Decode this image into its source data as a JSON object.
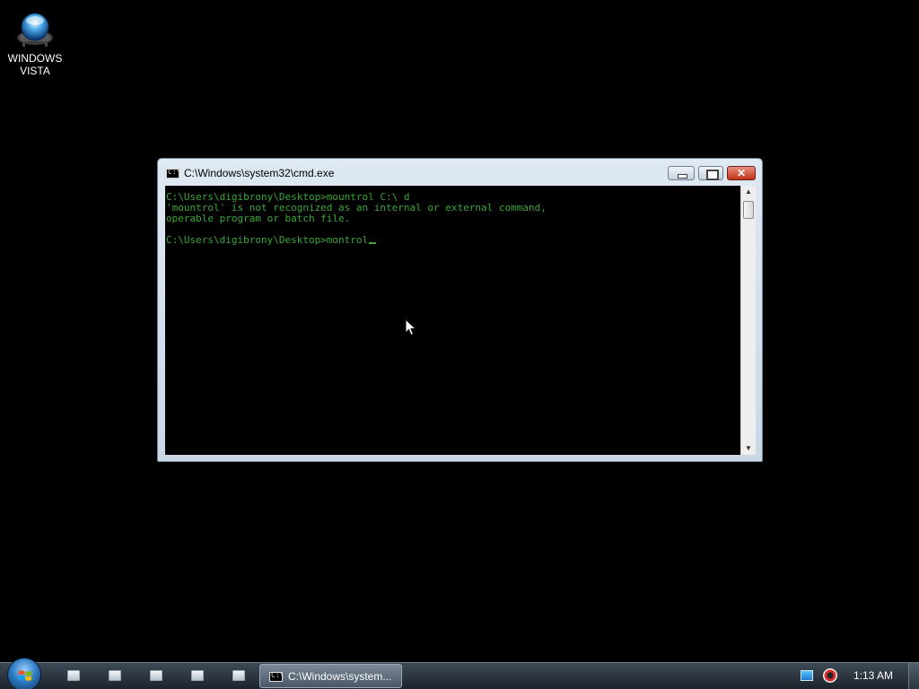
{
  "desktop": {
    "icons": [
      {
        "label": "WINDOWS\nVISTA",
        "icon": "vista-orb-icon"
      }
    ]
  },
  "window": {
    "title": "C:\\Windows\\system32\\cmd.exe",
    "icon": "cmd-icon",
    "buttons": {
      "minimize": "minimize",
      "maximize": "restore",
      "close": "✕"
    },
    "console_lines": [
      "C:\\Users\\digibrony\\Desktop>mountrol C:\\ d",
      "'mountrol' is not recognized as an internal or external command,",
      "operable program or batch file.",
      "",
      "C:\\Users\\digibrony\\Desktop>montrol"
    ],
    "text_color": "#3aa635",
    "background_color": "#000000"
  },
  "taskbar": {
    "start_icon": "windows-start-orb-icon",
    "quick_launch_count": 5,
    "task_button_label": "C:\\Windows\\system...",
    "tray_icons": [
      "network-icon",
      "volume-icon"
    ],
    "clock": "1:13 AM"
  }
}
